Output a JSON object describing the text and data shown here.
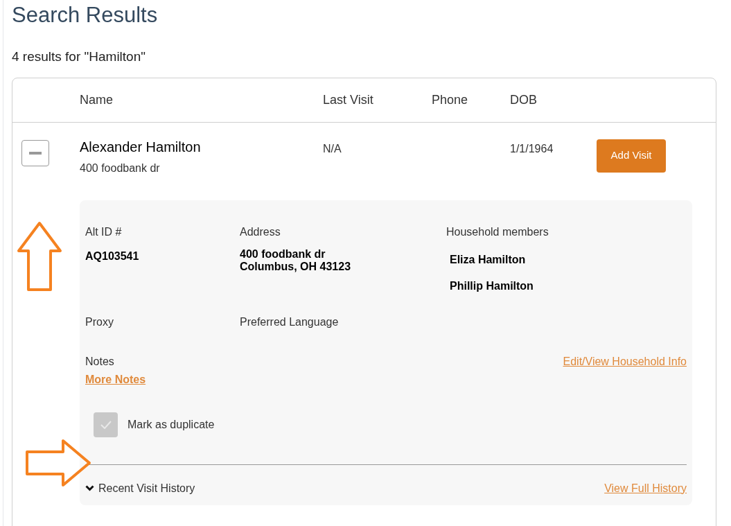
{
  "title": "Search Results",
  "summary": "4 results for \"Hamilton\"",
  "table": {
    "columns": [
      "Name",
      "Last Visit",
      "Phone",
      "DOB"
    ],
    "rows": [
      {
        "expanded": true,
        "name": "Alexander Hamilton",
        "address": "400 foodbank dr",
        "last_visit": "N/A",
        "dob": "1/1/1964",
        "action": "Add Visit",
        "details": {
          "alt_id_label": "Alt ID #",
          "alt_id": "AQ103541",
          "address_label": "Address",
          "address_lines": [
            "400 foodbank dr",
            "Columbus, OH 43123"
          ],
          "household_label": "Household members",
          "household_members": [
            "Eliza Hamilton",
            "Phillip Hamilton"
          ],
          "proxy_label": "Proxy",
          "language_label": "Preferred Language",
          "notes_label": "Notes",
          "more_notes": "More Notes",
          "edit_link": "Edit/View Household Info",
          "duplicate": {
            "label": "Mark as duplicate",
            "checked": false
          },
          "history_label": "Recent Visit History",
          "history_expanded": true,
          "full_history": "View Full History"
        }
      }
    ]
  }
}
